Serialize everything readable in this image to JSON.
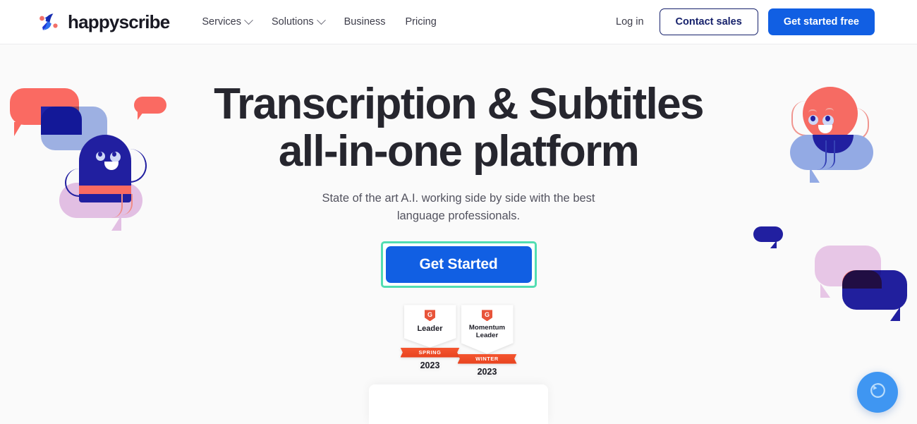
{
  "header": {
    "brand": {
      "name": "happyscribe",
      "logo_icon": "happyscribe-s-logo-icon"
    },
    "nav": [
      {
        "label": "Services",
        "has_dropdown": true,
        "icon": "chevron-down-icon"
      },
      {
        "label": "Solutions",
        "has_dropdown": true,
        "icon": "chevron-down-icon"
      },
      {
        "label": "Business",
        "has_dropdown": false,
        "icon": ""
      },
      {
        "label": "Pricing",
        "has_dropdown": false,
        "icon": ""
      }
    ],
    "login_label": "Log in",
    "contact_sales_label": "Contact sales",
    "get_started_free_label": "Get started free"
  },
  "hero": {
    "headline_line1": "Transcription & Subtitles",
    "headline_line2": "all-in-one platform",
    "subhead": "State of the art A.I. working side by side with the best language professionals.",
    "cta_label": "Get Started",
    "cta_highlighted": true
  },
  "badges": [
    {
      "logo": "g2-logo-icon",
      "logo_letter": "G",
      "title": "Leader",
      "season": "SPRING",
      "year": "2023"
    },
    {
      "logo": "g2-logo-icon",
      "logo_letter": "G",
      "title_line1": "Momentum",
      "title_line2": "Leader",
      "season": "WINTER",
      "year": "2023"
    }
  ],
  "chat_widget": {
    "icon": "chat-bubble-icon",
    "label": "Open chat"
  },
  "colors": {
    "brand_blue": "#115fe3",
    "navy": "#16216b",
    "highlight_ring": "#52ddb2",
    "coral": "#fa6a62",
    "light_blue": "#93aae4",
    "deep_navy": "#211fa0",
    "pink": "#e2bfe3",
    "g2_orange": "#e8543a",
    "page_bg": "#fafafa",
    "beacon_blue": "#3f96f2"
  }
}
